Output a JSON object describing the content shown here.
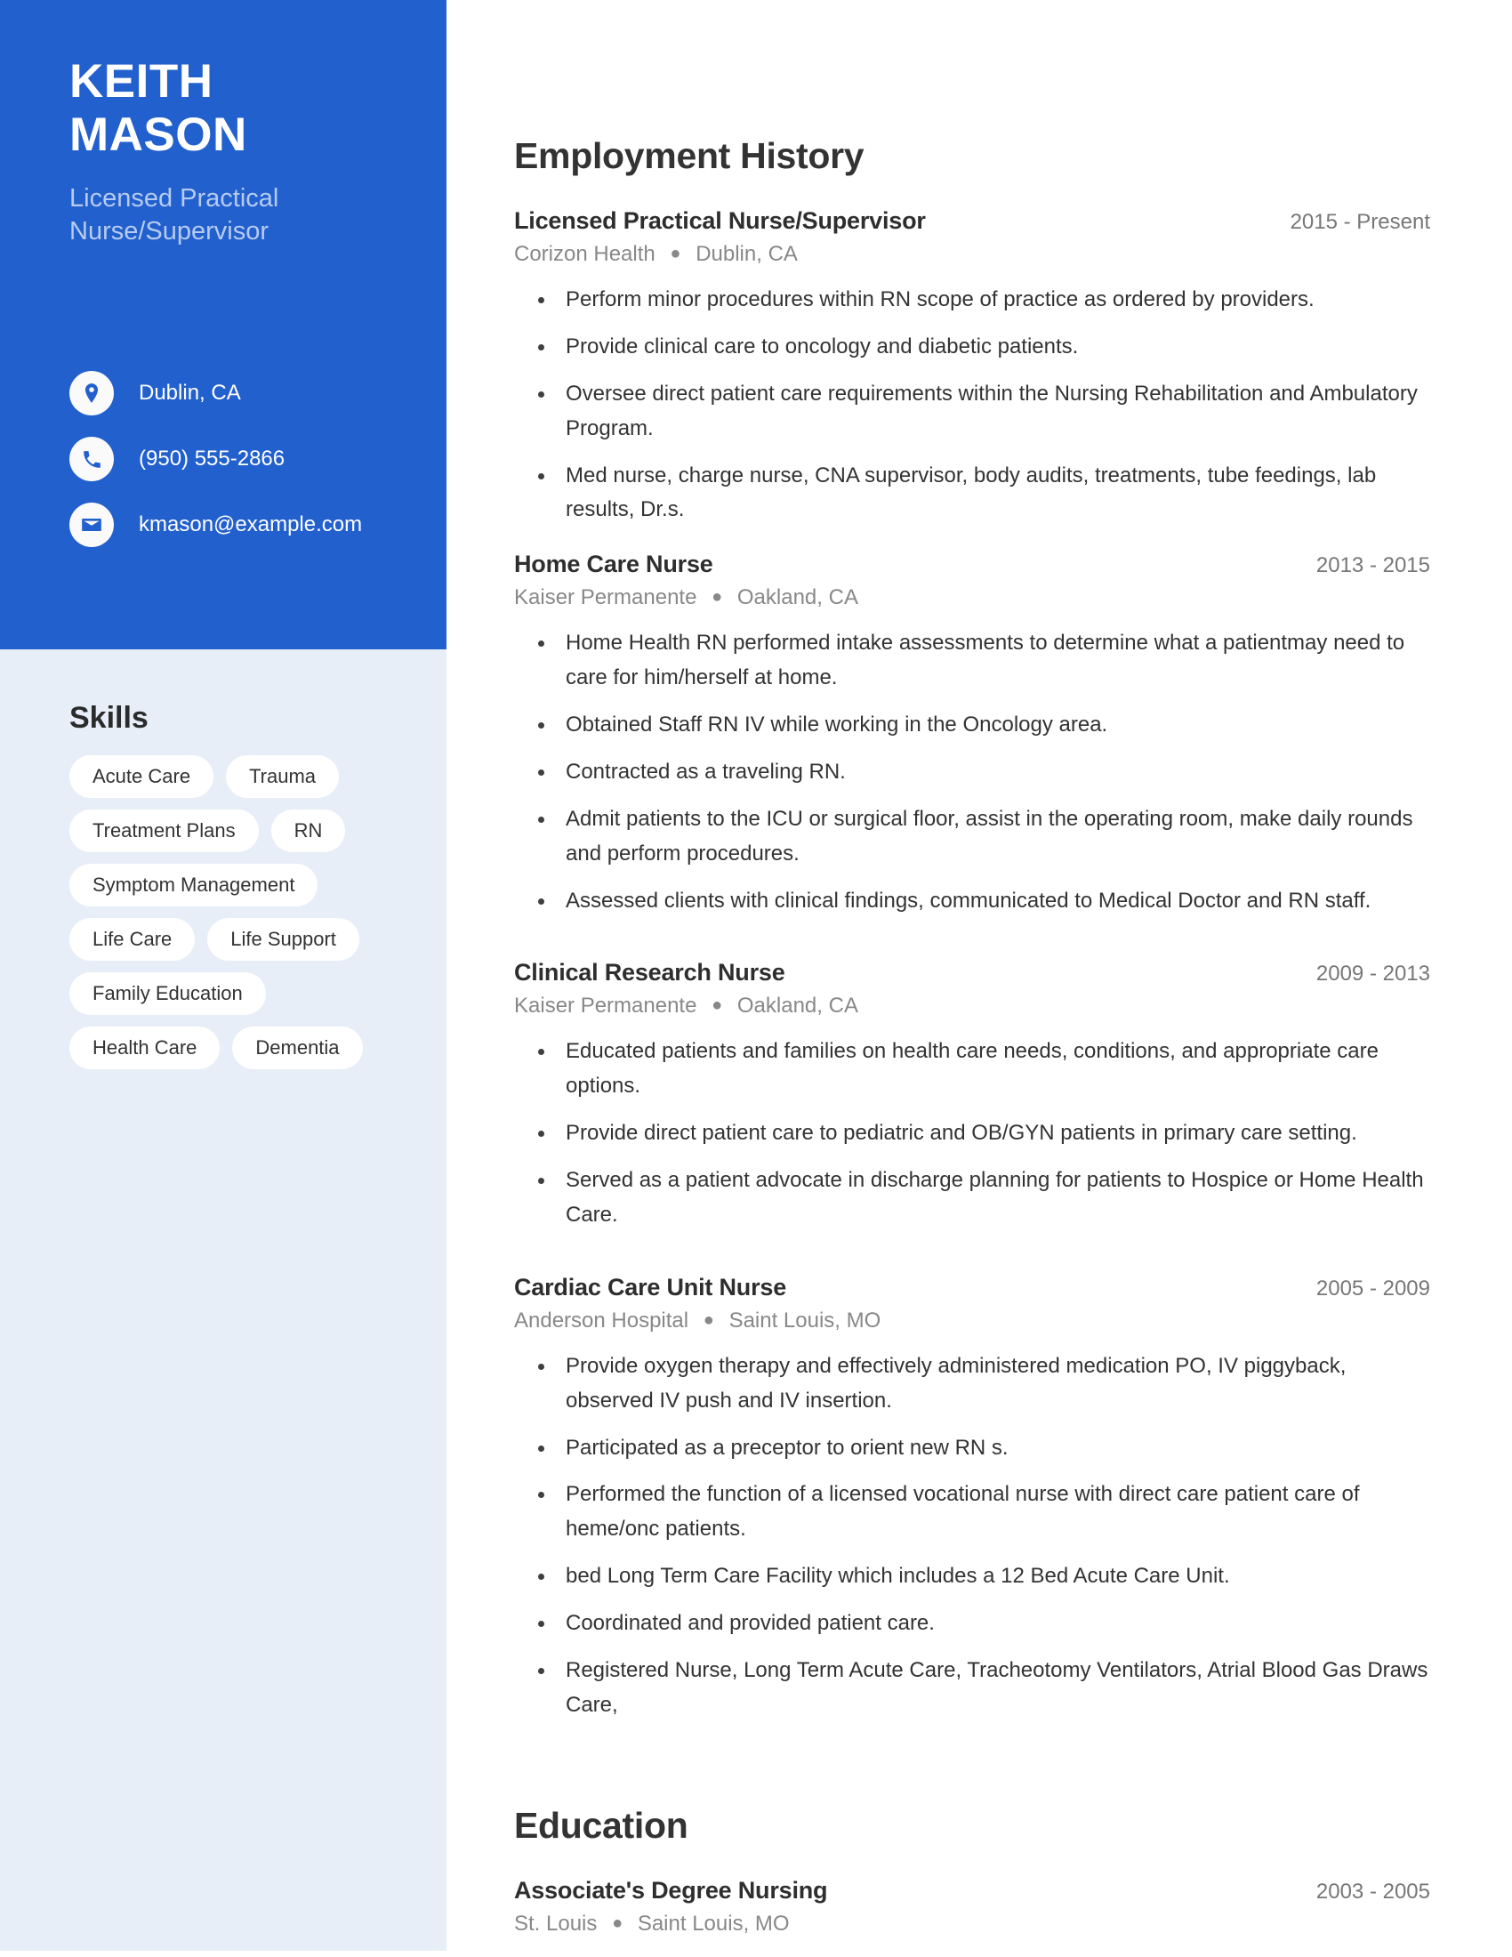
{
  "profile": {
    "first_name": "KEITH",
    "last_name": "MASON",
    "headline": "Licensed Practical Nurse/Supervisor",
    "contacts": [
      {
        "icon": "location-pin-icon",
        "value": "Dublin, CA"
      },
      {
        "icon": "phone-icon",
        "value": "(950) 555-2866"
      },
      {
        "icon": "envelope-icon",
        "value": "kmason@example.com"
      }
    ]
  },
  "skills": {
    "title": "Skills",
    "rows": [
      [
        "Acute Care",
        "Trauma"
      ],
      [
        "Treatment Plans",
        "RN"
      ],
      [
        "Symptom Management"
      ],
      [
        "Life Care",
        "Life Support"
      ],
      [
        "Family Education"
      ],
      [
        "Health Care",
        "Dementia"
      ]
    ]
  },
  "employment": {
    "title": "Employment History",
    "entries": [
      {
        "title": "Licensed Practical Nurse/Supervisor",
        "dates": "2015 - Present",
        "company": "Corizon Health",
        "location": "Dublin, CA",
        "bullets": [
          "Perform minor procedures within RN scope of practice as ordered by providers.",
          "Provide clinical care to oncology and diabetic patients.",
          "Oversee direct patient care requirements within the Nursing Rehabilitation and Ambulatory Program.",
          "Med nurse, charge nurse, CNA supervisor, body audits, treatments, tube feedings, lab results, Dr.s."
        ]
      },
      {
        "title": "Home Care Nurse",
        "dates": "2013 - 2015",
        "company": "Kaiser Permanente",
        "location": "Oakland, CA",
        "bullets": [
          "Home Health RN performed intake assessments to determine what a patientmay need to care for him/herself at home.",
          "Obtained Staff RN IV while working in the Oncology area.",
          "Contracted as a traveling RN.",
          "Admit patients to the ICU or surgical floor, assist in the operating room, make daily rounds and perform procedures.",
          "Assessed clients with clinical findings, communicated to Medical Doctor and RN staff."
        ]
      },
      {
        "title": "Clinical Research Nurse",
        "dates": "2009 - 2013",
        "company": "Kaiser Permanente",
        "location": "Oakland, CA",
        "bullets": [
          "Educated patients and families on health care needs, conditions, and appropriate care options.",
          "Provide direct patient care to pediatric and OB/GYN patients in primary care setting.",
          "Served as a patient advocate in discharge planning for patients to Hospice or Home Health Care."
        ]
      },
      {
        "title": "Cardiac Care Unit Nurse",
        "dates": "2005 - 2009",
        "company": "Anderson Hospital",
        "location": "Saint Louis, MO",
        "bullets": [
          "Provide oxygen therapy and effectively administered medication PO, IV piggyback, observed IV push and IV insertion.",
          "Participated as a preceptor to orient new RN s.",
          "Performed the function of a licensed vocational nurse with direct care patient care of heme/onc patients.",
          "bed Long Term Care Facility which includes a 12 Bed Acute Care Unit.",
          "Coordinated and provided patient care.",
          "Registered Nurse, Long Term Acute Care, Tracheotomy Ventilators, Atrial Blood Gas Draws Care,"
        ]
      }
    ]
  },
  "education": {
    "title": "Education",
    "entries": [
      {
        "title": "Associate's Degree Nursing",
        "dates": "2003 - 2005",
        "school": "St. Louis",
        "location": "Saint Louis, MO"
      }
    ]
  },
  "colors": {
    "sidebar_accent": "#2260ce",
    "sidebar_light": "#e8eef7",
    "headline_text": "#b6cbef",
    "body_text": "#333333",
    "muted_text": "#888888"
  }
}
